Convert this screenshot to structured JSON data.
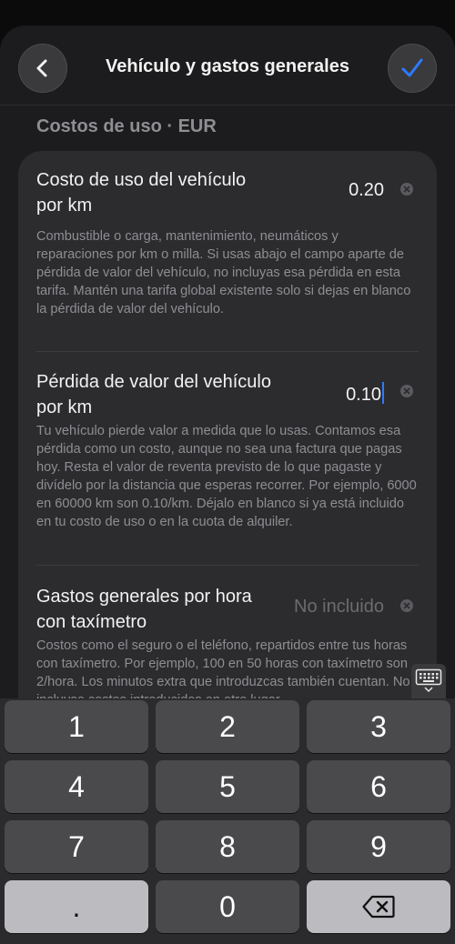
{
  "header": {
    "title": "Vehículo y gastos generales",
    "back_icon": "chevron-left-icon",
    "confirm_icon": "checkmark-icon",
    "accent_color": "#2b7bff"
  },
  "section": {
    "title": "Costos de uso · EUR"
  },
  "items": [
    {
      "label": "Costo de uso del vehículo por km",
      "value": "0.20",
      "description": "Combustible o carga, mantenimiento, neumáticos y reparaciones por km o milla. Si usas abajo el campo aparte de pérdida de valor del vehículo, no incluyas esa pérdida en esta tarifa. Mantén una tarifa global existente solo si dejas en blanco la pérdida de valor del vehículo."
    },
    {
      "label": "Pérdida de valor del vehículo por km",
      "value": "0.10",
      "description": "Tu vehículo pierde valor a medida que lo usas. Contamos esa pérdida como un costo, aunque no sea una factura que pagas hoy. Resta el valor de reventa previsto de lo que pagaste y divídelo por la distancia que esperas recorrer. Por ejemplo, 6000 en 60000 km son 0.10/km. Déjalo en blanco si ya está incluido en tu costo de uso o en la cuota de alquiler."
    },
    {
      "label": "Gastos generales por hora con taxímetro",
      "placeholder": "No incluido",
      "description": "Costos como el seguro o el teléfono, repartidos entre tus horas con taxímetro. Por ejemplo, 100 en 50 horas con taxímetro son 2/hora. Los minutos extra que introduzcas también cuentan. No incluyas costos introducidos en otro lugar."
    }
  ],
  "keyboard": {
    "keys": [
      "1",
      "2",
      "3",
      "4",
      "5",
      "6",
      "7",
      "8",
      "9",
      ".",
      "0"
    ],
    "delete_icon": "backspace-icon",
    "dismiss_icon": "keyboard-dismiss-icon"
  }
}
